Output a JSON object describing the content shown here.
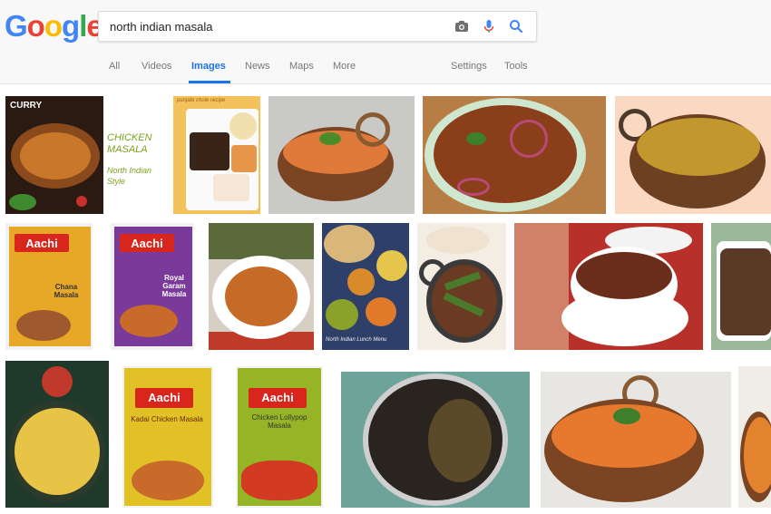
{
  "logo": {
    "letters": [
      "G",
      "o",
      "o",
      "g",
      "l",
      "e"
    ],
    "colors": [
      "#4285f4",
      "#ea4335",
      "#fbbc05",
      "#4285f4",
      "#34a853",
      "#ea4335"
    ]
  },
  "search": {
    "query": "north indian masala"
  },
  "tabs": [
    {
      "label": "All",
      "active": false
    },
    {
      "label": "Videos",
      "active": false
    },
    {
      "label": "Images",
      "active": true
    },
    {
      "label": "News",
      "active": false
    },
    {
      "label": "Maps",
      "active": false
    },
    {
      "label": "More",
      "active": false
    }
  ],
  "tools": {
    "settings": "Settings",
    "tools": "Tools"
  },
  "icons": {
    "camera": "camera-icon",
    "mic": "microphone-icon",
    "search": "search-icon"
  },
  "accent": "#1a73e8",
  "results": {
    "r1": {
      "curry": "CURRY",
      "title": "CHICKEN MASALA",
      "subtitle": "North Indian Style"
    },
    "r2_tag": "punjabi chole recipe",
    "box1": {
      "brand": "Aachi",
      "name": "Chana Masala"
    },
    "box2": {
      "brand": "Aachi",
      "name": "Royal Garam Masala"
    },
    "box3": {
      "brand": "Aachi",
      "name": "Kadai Chicken Masala"
    },
    "box4": {
      "brand": "Aachi",
      "name": "Chicken Lollypop Masala"
    },
    "watermark": "North Indian Lunch Menu"
  }
}
